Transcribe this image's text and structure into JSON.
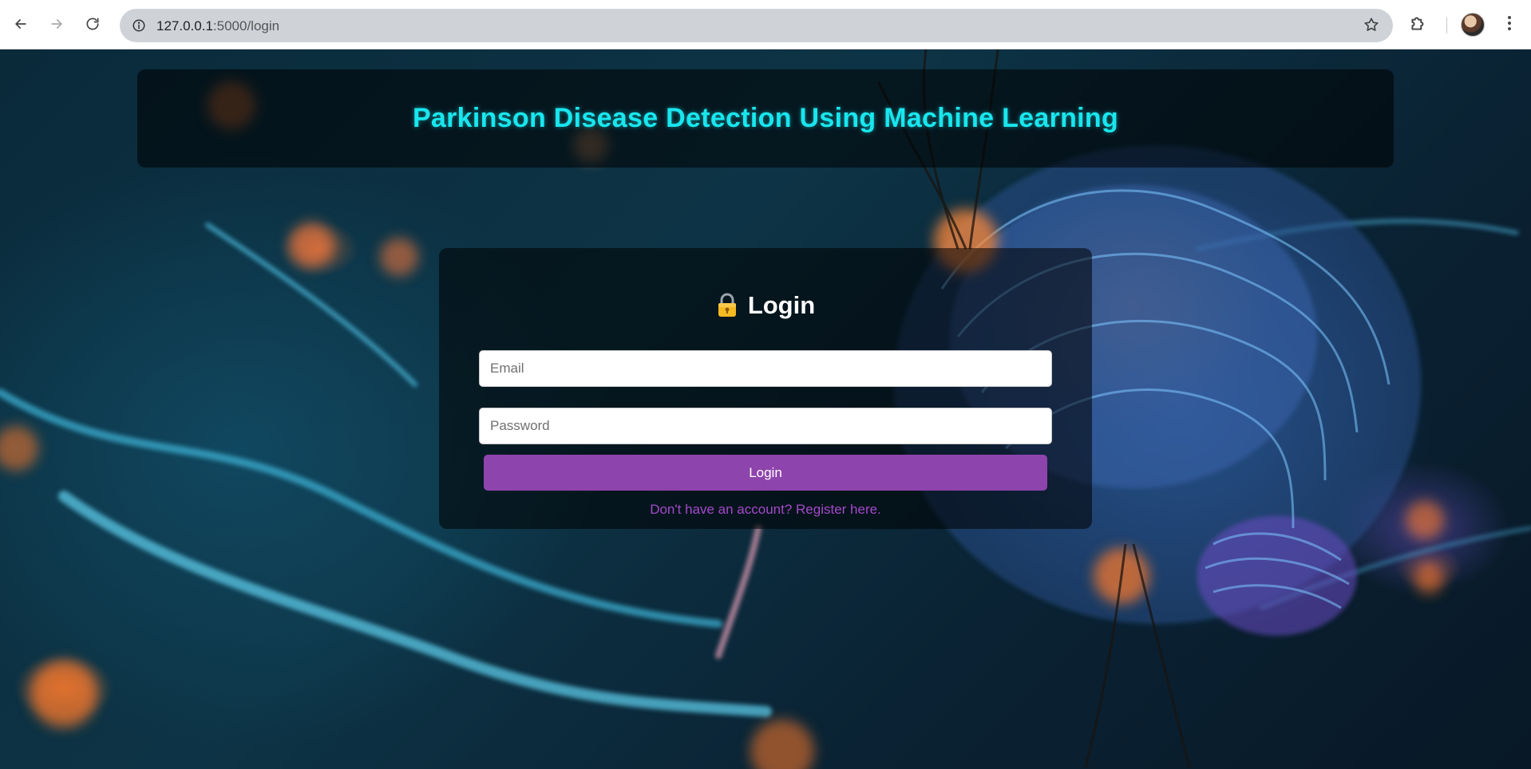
{
  "browser": {
    "url_host": "127.0.0.1",
    "url_path": ":5000/login",
    "icons": {
      "back": "back-arrow-icon",
      "forward": "forward-arrow-icon",
      "reload": "reload-icon",
      "site_info": "info-icon",
      "bookmark": "star-icon",
      "extensions": "puzzle-icon",
      "menu": "kebab-menu-icon"
    }
  },
  "page": {
    "banner_title": "Parkinson Disease Detection Using Machine Learning",
    "colors": {
      "title": "#19e6ee",
      "button": "#8e44ad",
      "link": "#a349c9"
    },
    "login": {
      "title": "Login",
      "lock_icon": "lock-icon",
      "email_placeholder": "Email",
      "password_placeholder": "Password",
      "submit_label": "Login",
      "register_text": "Don't have an account? Register here."
    }
  }
}
